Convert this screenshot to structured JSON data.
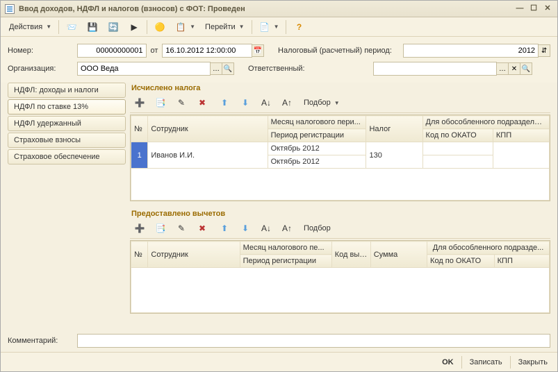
{
  "title": "Ввод доходов, НДФЛ и налогов (взносов) с ФОТ: Проведен",
  "toolbar": {
    "actions_label": "Действия",
    "goto_label": "Перейти"
  },
  "fields": {
    "number_label": "Номер:",
    "number_value": "00000000001",
    "from_label": "от",
    "date_value": "16.10.2012 12:00:00",
    "tax_period_label": "Налоговый (расчетный) период:",
    "tax_period_value": "2012",
    "org_label": "Организация:",
    "org_value": "ООО Веда",
    "resp_label": "Ответственный:",
    "resp_value": ""
  },
  "tabs": [
    {
      "label": "НДФЛ: доходы и налоги"
    },
    {
      "label": "НДФЛ по ставке 13%"
    },
    {
      "label": "НДФЛ удержанный"
    },
    {
      "label": "Страховые взносы"
    },
    {
      "label": "Страховое обеспечение"
    }
  ],
  "active_tab": 1,
  "section1": {
    "title": "Исчислено налога",
    "selection_label": "Подбор",
    "cols": {
      "num": "№",
      "employee": "Сотрудник",
      "month_tax": "Месяц налогового пери...",
      "reg_period": "Период регистрации",
      "tax": "Налог",
      "subdiv": "Для обособленного подразделения",
      "okato": "Код по ОКАТО",
      "kpp": "КПП"
    },
    "rows": [
      {
        "num": "1",
        "employee": "Иванов И.И.",
        "month_tax": "Октябрь 2012",
        "reg_period": "Октябрь 2012",
        "tax": "130",
        "okato": "",
        "kpp": ""
      }
    ]
  },
  "section2": {
    "title": "Предоставлено вычетов",
    "selection_label": "Подбор",
    "cols": {
      "num": "№",
      "employee": "Сотрудник",
      "month_tax": "Месяц налогового пе...",
      "reg_period": "Период регистрации",
      "deduct_code": "Код вычета",
      "amount": "Сумма",
      "subdiv": "Для обособленного подразде...",
      "okato": "Код по ОКАТО",
      "kpp": "КПП"
    }
  },
  "comment_label": "Комментарий:",
  "comment_value": "",
  "footer": {
    "ok": "OK",
    "save": "Записать",
    "close": "Закрыть"
  }
}
